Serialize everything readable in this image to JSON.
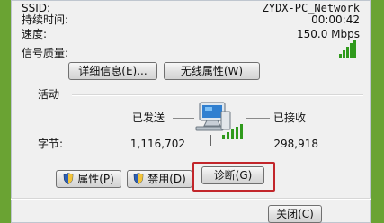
{
  "connection": {
    "ssid_label": "SSID:",
    "ssid_value": "ZYDX-PC_Network",
    "duration_label": "持续时间:",
    "duration_value": "00:00:42",
    "speed_label": "速度:",
    "speed_value": "150.0 Mbps",
    "signal_label": "信号质量:",
    "signal_bars": 5,
    "details_button": "详细信息(E)...",
    "wireless_props_button": "无线属性(W)"
  },
  "activity": {
    "section_label": "活动",
    "sent_label": "已发送",
    "received_label": "已接收",
    "bytes_label": "字节:",
    "bytes_sent": "1,116,702",
    "bytes_received": "298,918"
  },
  "actions": {
    "properties_button": "属性(P)",
    "disable_button": "禁用(D)",
    "diagnose_button": "诊断(G)",
    "close_button": "关闭(C)"
  },
  "colors": {
    "highlight_border": "#c2262b",
    "signal_green": "#2f9a1c",
    "desktop_green": "#6aa333"
  }
}
